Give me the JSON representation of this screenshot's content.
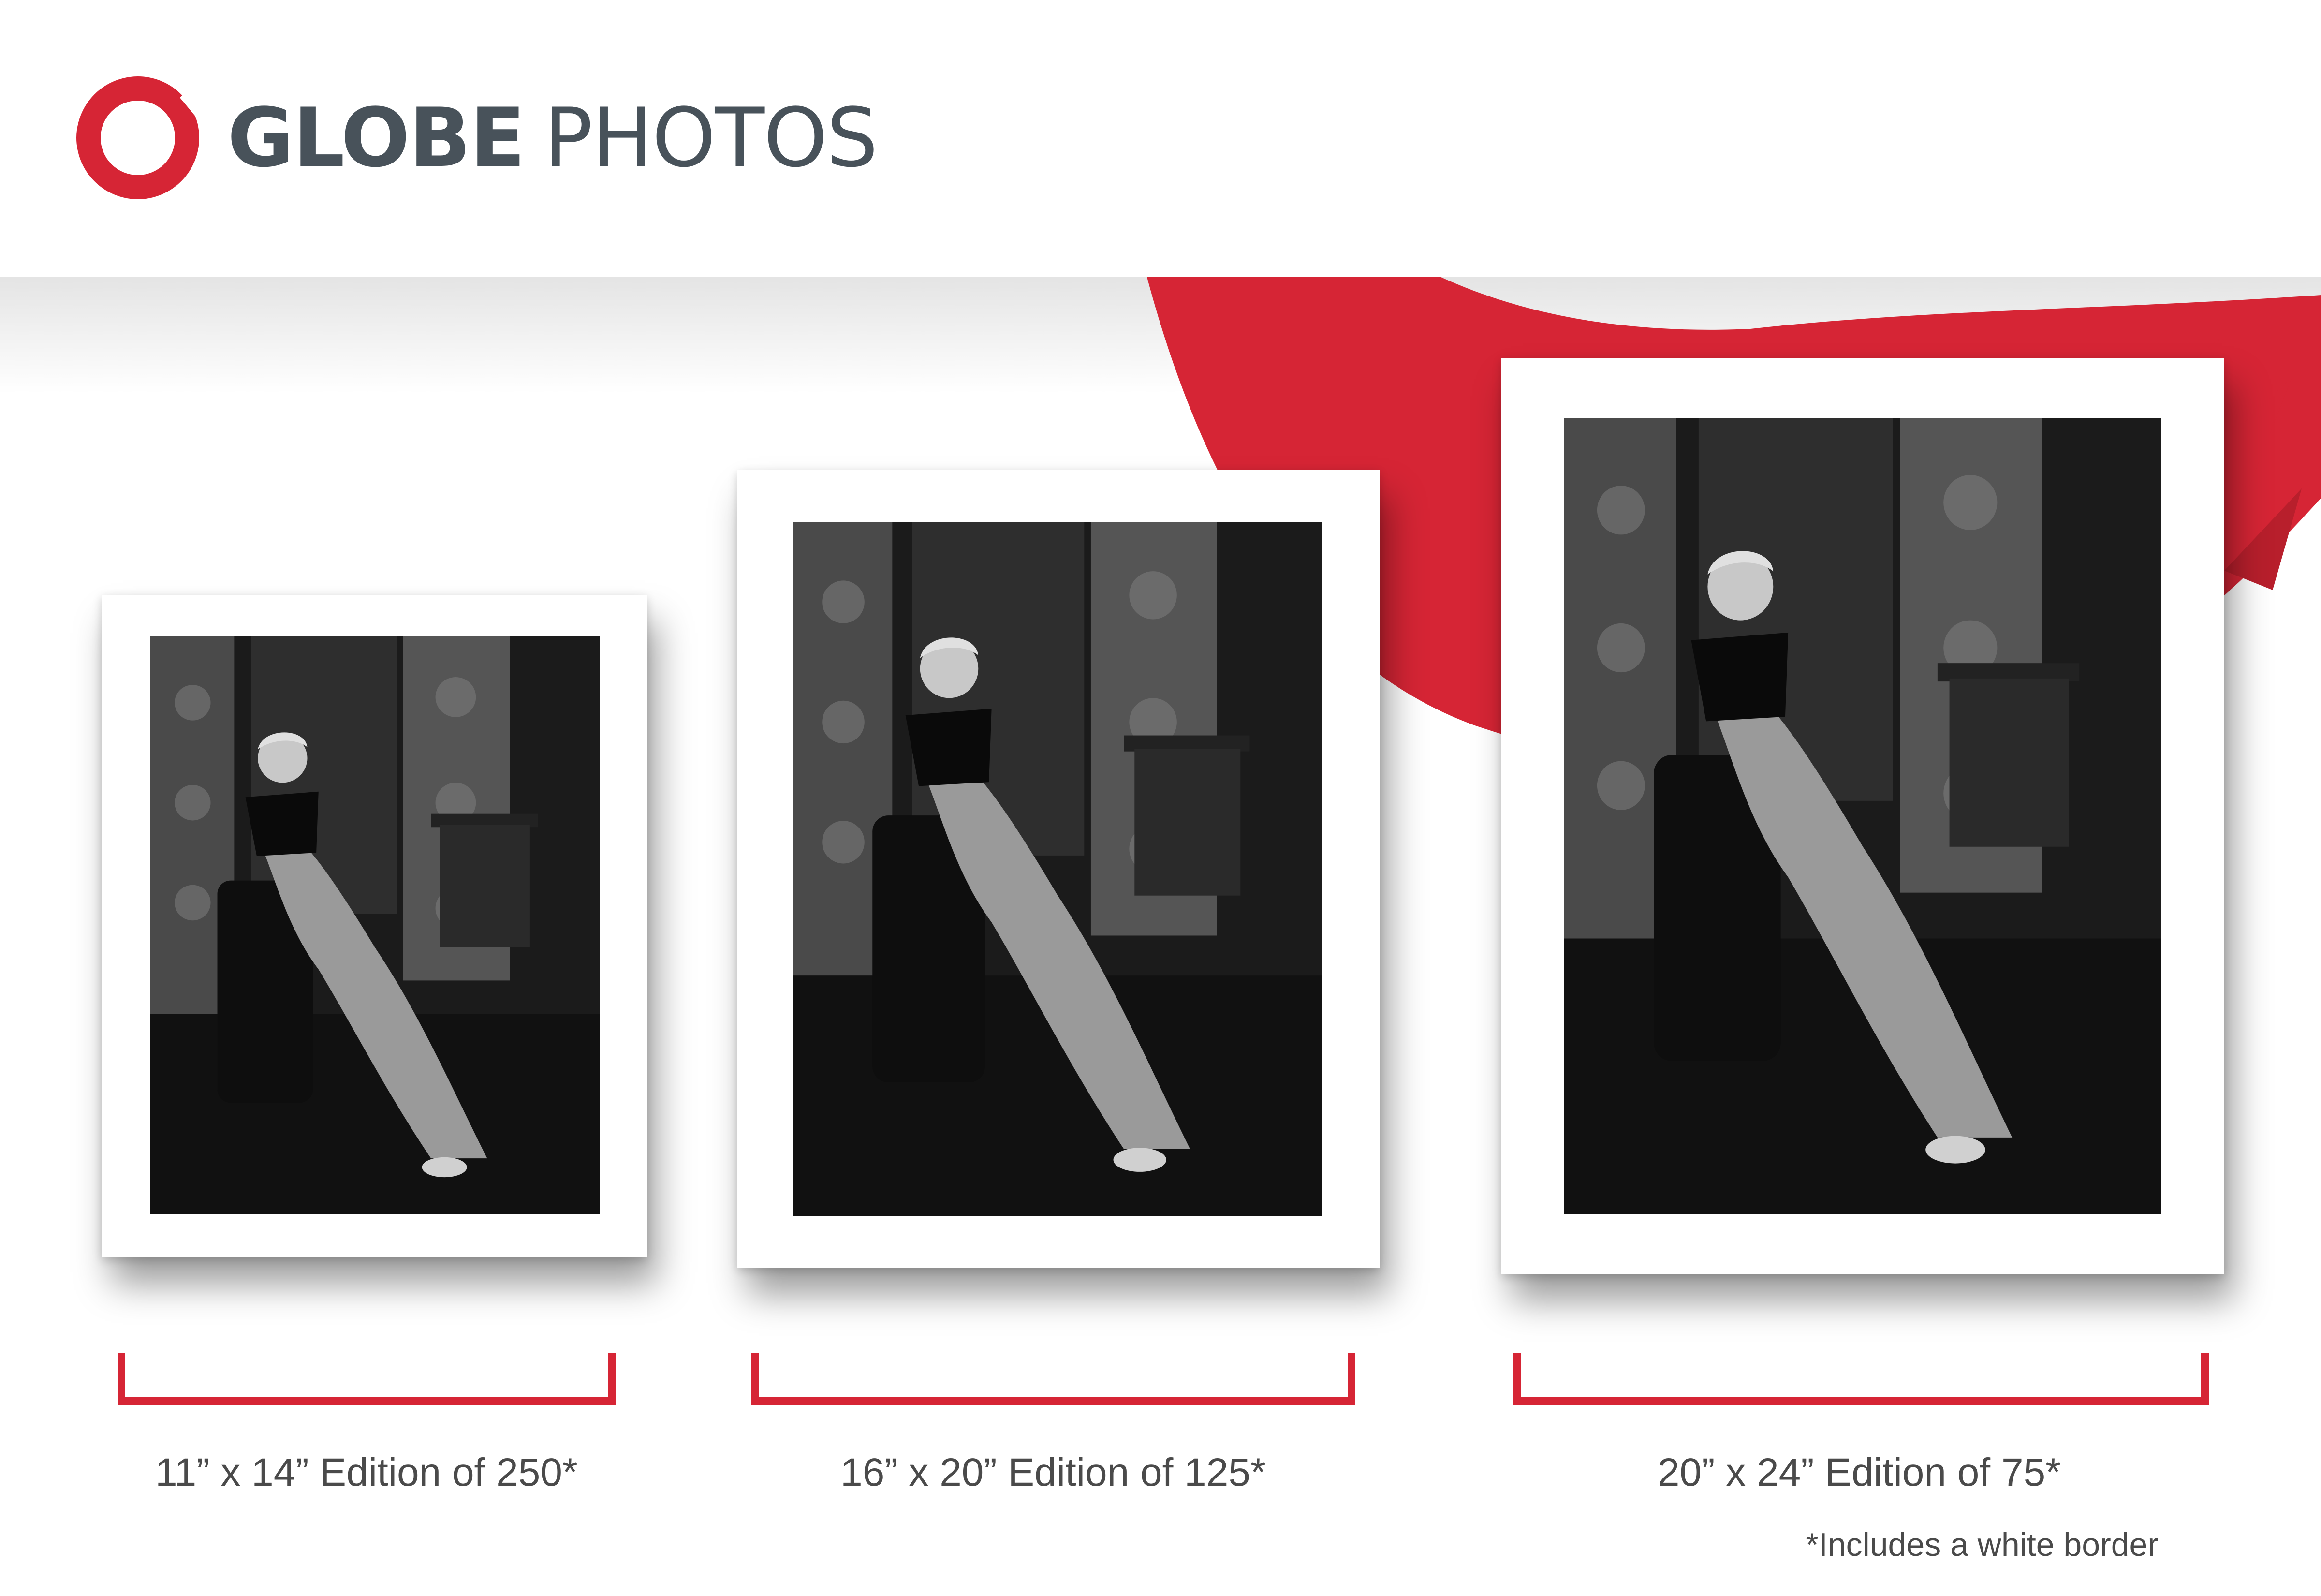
{
  "brand": {
    "name_bold": "GLOBE",
    "name_light": "PHOTOS",
    "logo_icon": "red-ring-brushstroke-icon",
    "accent_color": "#d62535",
    "text_color": "#48525a"
  },
  "editions": [
    {
      "size_label": "11” x 14” Edition of 250*"
    },
    {
      "size_label": "16” x 20” Edition of 125*"
    },
    {
      "size_label": "20” x 24” Edition of 75*"
    }
  ],
  "footnote": "*Includes a white border"
}
